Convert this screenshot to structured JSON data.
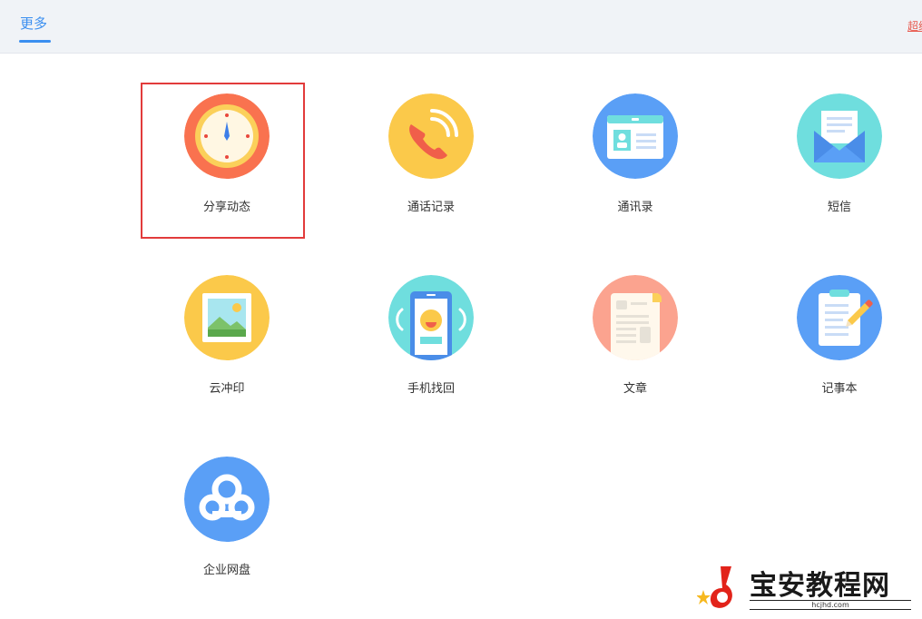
{
  "header": {
    "tab_label": "更多",
    "right_link": "超级"
  },
  "apps": [
    {
      "label": "分享动态",
      "icon": "clock-icon",
      "color": "#f9724f",
      "selected": true
    },
    {
      "label": "通话记录",
      "icon": "phone-icon",
      "color": "#fbc94a"
    },
    {
      "label": "通讯录",
      "icon": "contact-card-icon",
      "color": "#5a9ff6"
    },
    {
      "label": "短信",
      "icon": "envelope-icon",
      "color": "#6fdede"
    },
    {
      "label": "云冲印",
      "icon": "photo-icon",
      "color": "#fbc94a"
    },
    {
      "label": "手机找回",
      "icon": "phone-smile-icon",
      "color": "#6fdede"
    },
    {
      "label": "文章",
      "icon": "document-icon",
      "color": "#fba38f"
    },
    {
      "label": "记事本",
      "icon": "notepad-icon",
      "color": "#5a9ff6"
    },
    {
      "label": "企业网盘",
      "icon": "cloud-icon",
      "color": "#5a9ff6"
    }
  ],
  "watermark": {
    "title": "宝安教程网",
    "url": "hcjhd.com"
  }
}
